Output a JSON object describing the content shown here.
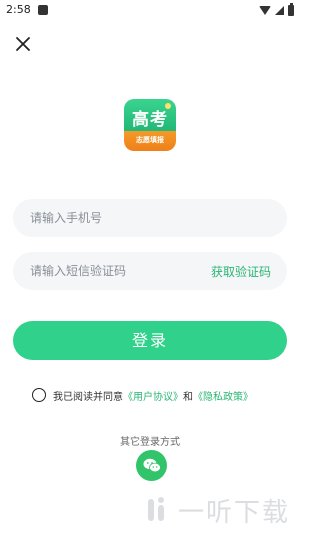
{
  "status_bar": {
    "time": "2:58",
    "icons": [
      "notification-icon",
      "wifi-icon",
      "signal-icon",
      "battery-icon"
    ]
  },
  "header": {
    "close_icon": "close-icon"
  },
  "logo": {
    "line1": "高考",
    "line2": "志愿填报",
    "colors": {
      "green": "#2dc47f",
      "orange": "#f39a28"
    }
  },
  "form": {
    "phone_placeholder": "请输入手机号",
    "phone_value": "",
    "code_placeholder": "请输入短信验证码",
    "code_value": "",
    "get_code_label": "获取验证码"
  },
  "login_button": {
    "label": "登录",
    "color": "#30d18a"
  },
  "agreement": {
    "prefix": "我已阅读并同意",
    "user_agreement": "《用户协议》",
    "and": "和",
    "privacy_policy": "《隐私政策》",
    "checked": false
  },
  "other_login": {
    "label": "其它登录方式",
    "wechat_icon": "wechat-icon"
  },
  "watermark": {
    "text": "一听下载"
  },
  "accent_color": "#2bb673"
}
